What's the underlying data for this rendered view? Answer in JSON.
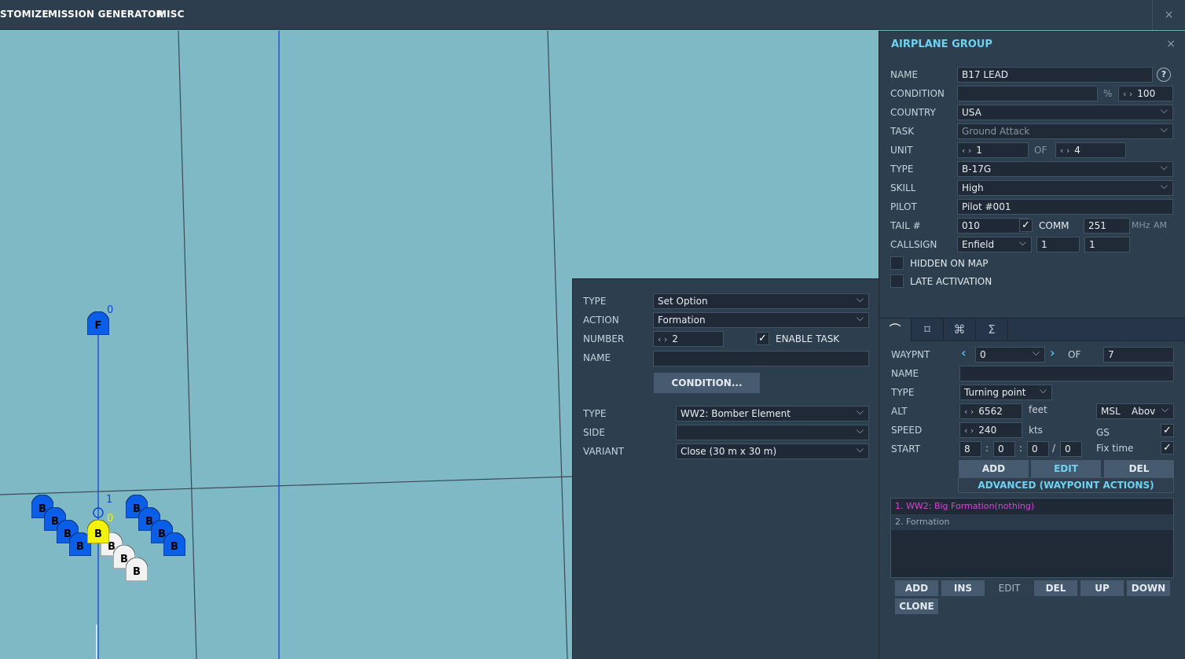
{
  "menu": {
    "items": [
      "STOMIZE",
      "MISSION GENERATOR",
      "MISC"
    ],
    "close_glyph": "×"
  },
  "map": {
    "markers": {
      "fighter_label": "F",
      "fighter_index": "0",
      "bomber_label": "B",
      "waypoint_index_1": "1",
      "waypoint_index_0": "0"
    }
  },
  "trigger": {
    "type_label": "TYPE",
    "type_value": "Set Option",
    "action_label": "ACTION",
    "action_value": "Formation",
    "number_label": "NUMBER",
    "number_value": "2",
    "enable_task_label": "ENABLE TASK",
    "enable_task_checked": true,
    "name_label": "NAME",
    "name_value": "",
    "condition_button": "CONDITION...",
    "form_type_label": "TYPE",
    "form_type_value": "WW2: Bomber Element",
    "side_label": "SIDE",
    "side_value": "",
    "variant_label": "VARIANT",
    "variant_value": "Close (30 m x 30 m)"
  },
  "group": {
    "title": "AIRPLANE GROUP",
    "close_glyph": "×",
    "help_glyph": "?",
    "name_label": "NAME",
    "name_value": "B17 LEAD",
    "condition_label": "CONDITION",
    "condition_value": "",
    "percent_label": "%",
    "percent_value": "100",
    "country_label": "COUNTRY",
    "country_value": "USA",
    "task_label": "TASK",
    "task_value": "Ground Attack",
    "unit_label": "UNIT",
    "unit_value": "1",
    "unit_of_label": "OF",
    "unit_total": "4",
    "type_label": "TYPE",
    "type_value": "B-17G",
    "skill_label": "SKILL",
    "skill_value": "High",
    "pilot_label": "PILOT",
    "pilot_value": "Pilot #001",
    "tail_label": "TAIL #",
    "tail_value": "010",
    "comm_label": "COMM",
    "comm_checked": true,
    "comm_value": "251",
    "mhz_label": "MHz",
    "am_label": "AM",
    "callsign_label": "CALLSIGN",
    "callsign_value": "Enfield",
    "callsign_num1": "1",
    "callsign_num2": "1",
    "hidden_label": "HIDDEN ON MAP",
    "hidden_checked": false,
    "late_label": "LATE ACTIVATION",
    "late_checked": false
  },
  "tabs": {
    "icons": [
      "route-icon",
      "target-icon",
      "payload-icon",
      "summary-icon"
    ],
    "glyphs": [
      "⌒",
      "⌑",
      "⌘",
      "Σ"
    ],
    "active_index": 0
  },
  "waypoint": {
    "waypnt_label": "WAYPNT",
    "waypnt_value": "0",
    "of_label": "OF",
    "total_value": "7",
    "name_label": "NAME",
    "name_value": "",
    "type_label": "TYPE",
    "type_value": "Turning point",
    "alt_label": "ALT",
    "alt_value": "6562",
    "alt_unit": "feet",
    "alt_ref": "MSL",
    "alt_ref2": "Abov",
    "speed_label": "SPEED",
    "speed_value": "240",
    "speed_unit": "kts",
    "gs_label": "GS",
    "gs_checked": true,
    "start_label": "START",
    "start_d": "8",
    "start_sep1": ":",
    "start_h": "0",
    "start_sep2": ":",
    "start_m": "0",
    "start_sep3": "/",
    "start_s": "0",
    "fix_time_label": "Fix time",
    "fix_time_checked": true,
    "add_button": "ADD",
    "edit_button": "EDIT",
    "del_button": "DEL",
    "advanced_button": "ADVANCED (WAYPOINT ACTIONS)",
    "actions": [
      "1. WW2: Big Formation(nothing)",
      "2. Formation"
    ],
    "list_buttons": {
      "add": "ADD",
      "ins": "INS",
      "edit": "EDIT",
      "del": "DEL",
      "up": "UP",
      "down": "DOWN",
      "clone": "CLONE"
    }
  },
  "colors": {
    "map_background": "#7fb9c5",
    "panel": "#2d3e4f",
    "accent": "#6ed1f0",
    "blue_unit": "#0a5ee8",
    "selected_unit": "#f2f20a",
    "neutral_unit": "#f2f2f2",
    "action_highlight": "#d845d8"
  }
}
